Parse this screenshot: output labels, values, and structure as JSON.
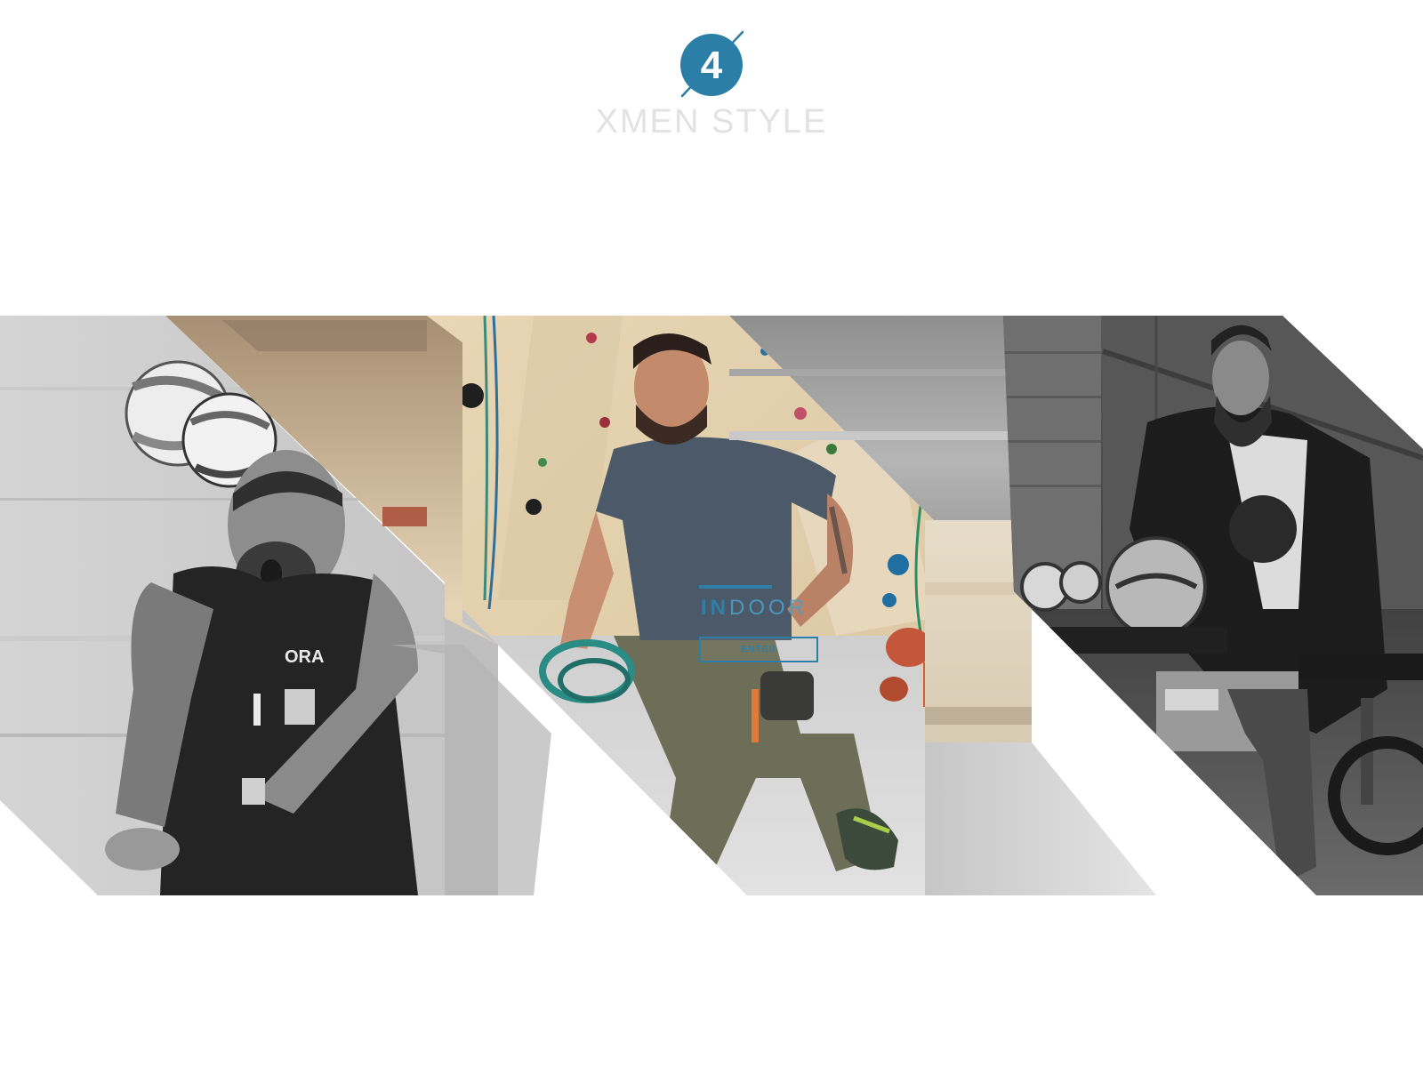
{
  "header": {
    "logo_number": "4",
    "brand_name": "XMEN STYLE",
    "accent_color": "#2b7ea6",
    "brand_color": "#e2e2e2"
  },
  "hero": {
    "panels": [
      {
        "name": "beach-volleyball-panel",
        "style": "grayscale"
      },
      {
        "name": "indoor-climbing-panel",
        "style": "color"
      },
      {
        "name": "motorcycle-rider-panel",
        "style": "grayscale"
      }
    ],
    "feature": {
      "title_strong": "IN",
      "title_light": "DOOR",
      "button_label": "ENTER",
      "accent_color": "#2e7fa6"
    }
  }
}
